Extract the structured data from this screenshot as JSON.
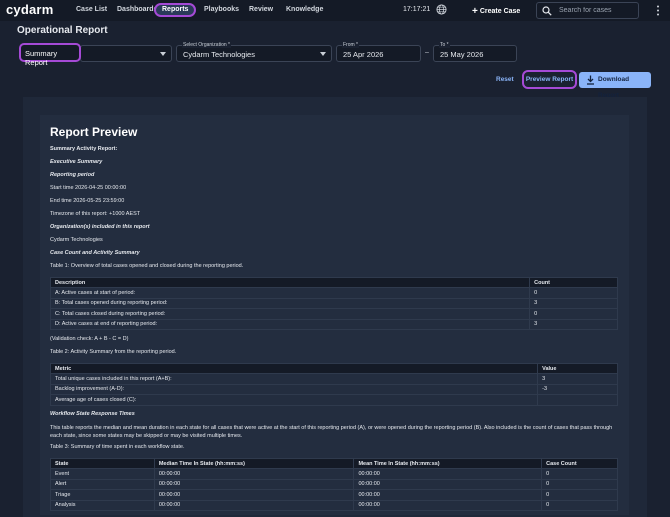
{
  "app": {
    "logo": "cydarm"
  },
  "nav": {
    "items": [
      "Case List",
      "Dashboards",
      "Reports",
      "Playbooks",
      "Review",
      "Knowledge"
    ],
    "active": "Reports"
  },
  "topbar": {
    "clock": "17:17:21",
    "create_case": "Create Case",
    "search_placeholder": "Search for cases"
  },
  "page": {
    "title": "Operational Report"
  },
  "filters": {
    "report_type": "Summary Report",
    "org_label": "Select Organization *",
    "org_value": "Cydarm Technologies",
    "from_label": "From *",
    "from_value": "25 Apr 2026",
    "to_label": "To *",
    "to_value": "25 May 2026",
    "range_dash": "–"
  },
  "actions": {
    "reset": "Reset",
    "preview": "Preview Report",
    "download": "Download Report"
  },
  "report": {
    "title": "Report Preview",
    "heading": "Summary Activity Report:",
    "exec_summary": "Executive Summary",
    "reporting_period": "Reporting period",
    "start": "Start time 2026-04-25 00:00:00",
    "end": "End time 2026-05-25 23:59:00",
    "timezone": "Timezone of this report: +1000 AEST",
    "orgs_heading": "Organization(s) included in this report",
    "org": "Cydarm Technologies",
    "case_count_heading": "Case Count and Activity Summary",
    "table1_caption": "Table 1: Overview of total cases opened and closed during the reporting period.",
    "table1": {
      "headers": [
        "Description",
        "Count"
      ],
      "rows": [
        [
          "A: Active cases at start of period:",
          "0"
        ],
        [
          "B: Total cases opened during reporting period:",
          "3"
        ],
        [
          "C: Total cases closed during reporting period:",
          "0"
        ],
        [
          "D: Active cases at end of reporting period:",
          "3"
        ]
      ]
    },
    "validation": "(Validation check: A + B - C = D)",
    "table2_caption": "Table 2: Activity Summary from the reporting period.",
    "table2": {
      "headers": [
        "Metric",
        "Value"
      ],
      "rows": [
        [
          "Total unique cases included in this report (A+B):",
          "3"
        ],
        [
          "Backlog improvement (A-D):",
          "-3"
        ],
        [
          "Average age of cases closed (C):",
          ""
        ]
      ]
    },
    "workflow_heading": "Workflow State Response Times",
    "workflow_text": "This table reports the median and mean duration in each state for all cases that were active at the start of this reporting period (A), or were opened during the reporting period (B). Also included is the count of cases that pass through each state, since some states may be skipped or may be visited multiple times.",
    "table3_caption": "Table 3: Summary of time spent in each workflow state.",
    "table3": {
      "headers": [
        "State",
        "Median Time In State (hh:mm:ss)",
        "Mean Time In State (hh:mm:ss)",
        "Case Count"
      ],
      "rows": [
        [
          "Event",
          "00:00:00",
          "00:00:00",
          "0"
        ],
        [
          "Alert",
          "00:00:00",
          "00:00:00",
          "0"
        ],
        [
          "Triage",
          "00:00:00",
          "00:00:00",
          "0"
        ],
        [
          "Analysis",
          "00:00:00",
          "00:00:00",
          "0"
        ]
      ]
    }
  }
}
